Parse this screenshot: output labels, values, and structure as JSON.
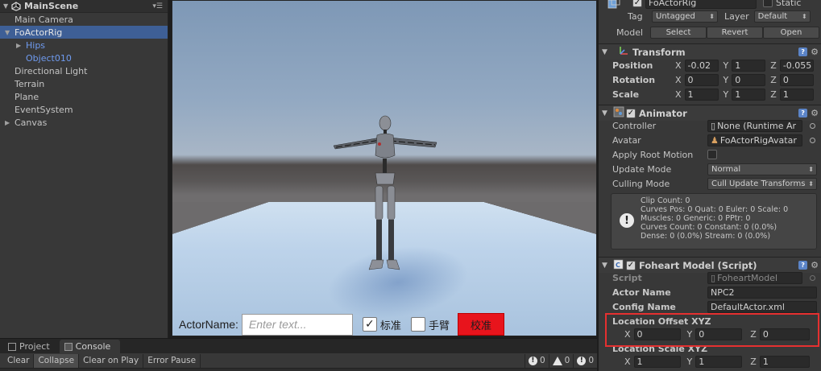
{
  "hierarchy": {
    "scene": "MainScene",
    "items": [
      {
        "label": "Main Camera",
        "indent": 0,
        "arrow": "",
        "selected": false,
        "blue": false
      },
      {
        "label": "FoActorRig",
        "indent": 0,
        "arrow": "▼",
        "selected": true,
        "blue": false
      },
      {
        "label": "Hips",
        "indent": 1,
        "arrow": "▶",
        "selected": false,
        "blue": true
      },
      {
        "label": "Object010",
        "indent": 1,
        "arrow": "",
        "selected": false,
        "blue": true
      },
      {
        "label": "Directional Light",
        "indent": 0,
        "arrow": "",
        "selected": false,
        "blue": false
      },
      {
        "label": "Terrain",
        "indent": 0,
        "arrow": "",
        "selected": false,
        "blue": false
      },
      {
        "label": "Plane",
        "indent": 0,
        "arrow": "",
        "selected": false,
        "blue": false
      },
      {
        "label": "EventSystem",
        "indent": 0,
        "arrow": "",
        "selected": false,
        "blue": false
      },
      {
        "label": "Canvas",
        "indent": 0,
        "arrow": "▶",
        "selected": false,
        "blue": false
      }
    ]
  },
  "game_ui": {
    "actor_label": "ActorName:",
    "actor_placeholder": "Enter text...",
    "standard_label": "标准",
    "standard_checked": true,
    "arm_label": "手臂",
    "arm_checked": false,
    "calibrate_label": "校准",
    "calibrate_color": "#e8141c"
  },
  "console": {
    "tabs": [
      "Project",
      "Console"
    ],
    "active_tab": "Console",
    "toolbar": [
      "Clear",
      "Collapse",
      "Clear on Play",
      "Error Pause"
    ],
    "counts": {
      "info": "0",
      "warning": "0",
      "error": "0"
    }
  },
  "inspector": {
    "object_name": "FoActorRig",
    "static_label": "Static",
    "tag_label": "Tag",
    "tag_value": "Untagged",
    "layer_label": "Layer",
    "layer_value": "Default",
    "model_label": "Model",
    "model_buttons": [
      "Select",
      "Revert",
      "Open"
    ],
    "transform": {
      "title": "Transform",
      "rows": [
        {
          "label": "Position",
          "x": "-0.02",
          "y": "1",
          "z": "-0.055"
        },
        {
          "label": "Rotation",
          "x": "0",
          "y": "0",
          "z": "0"
        },
        {
          "label": "Scale",
          "x": "1",
          "y": "1",
          "z": "1"
        }
      ]
    },
    "animator": {
      "title": "Animator",
      "controller_label": "Controller",
      "controller_value": "None (Runtime Ar",
      "avatar_label": "Avatar",
      "avatar_value": "FoActorRigAvatar",
      "root_motion_label": "Apply Root Motion",
      "update_mode_label": "Update Mode",
      "update_mode_value": "Normal",
      "culling_mode_label": "Culling Mode",
      "culling_mode_value": "Cull Update Transforms",
      "stats": [
        "Clip Count: 0",
        "Curves Pos: 0 Quat: 0 Euler: 0 Scale: 0",
        "Muscles: 0 Generic: 0 PPtr: 0",
        "Curves Count: 0 Constant: 0 (0.0%)",
        "Dense: 0 (0.0%) Stream: 0 (0.0%)"
      ]
    },
    "script_comp": {
      "title": "Foheart Model (Script)",
      "script_label": "Script",
      "script_value": "FoheartModel",
      "actor_name_label": "Actor Name",
      "actor_name_value": "NPC2",
      "config_name_label": "Config Name",
      "config_name_value": "DefaultActor.xml",
      "loc_offset_label": "Location Offset XYZ",
      "loc_offset": {
        "x": "0",
        "y": "0",
        "z": "0"
      },
      "loc_scale_label": "Location Scale XYZ",
      "loc_scale": {
        "x": "1",
        "y": "1",
        "z": "1"
      }
    },
    "highlight_color": "#e53030"
  }
}
